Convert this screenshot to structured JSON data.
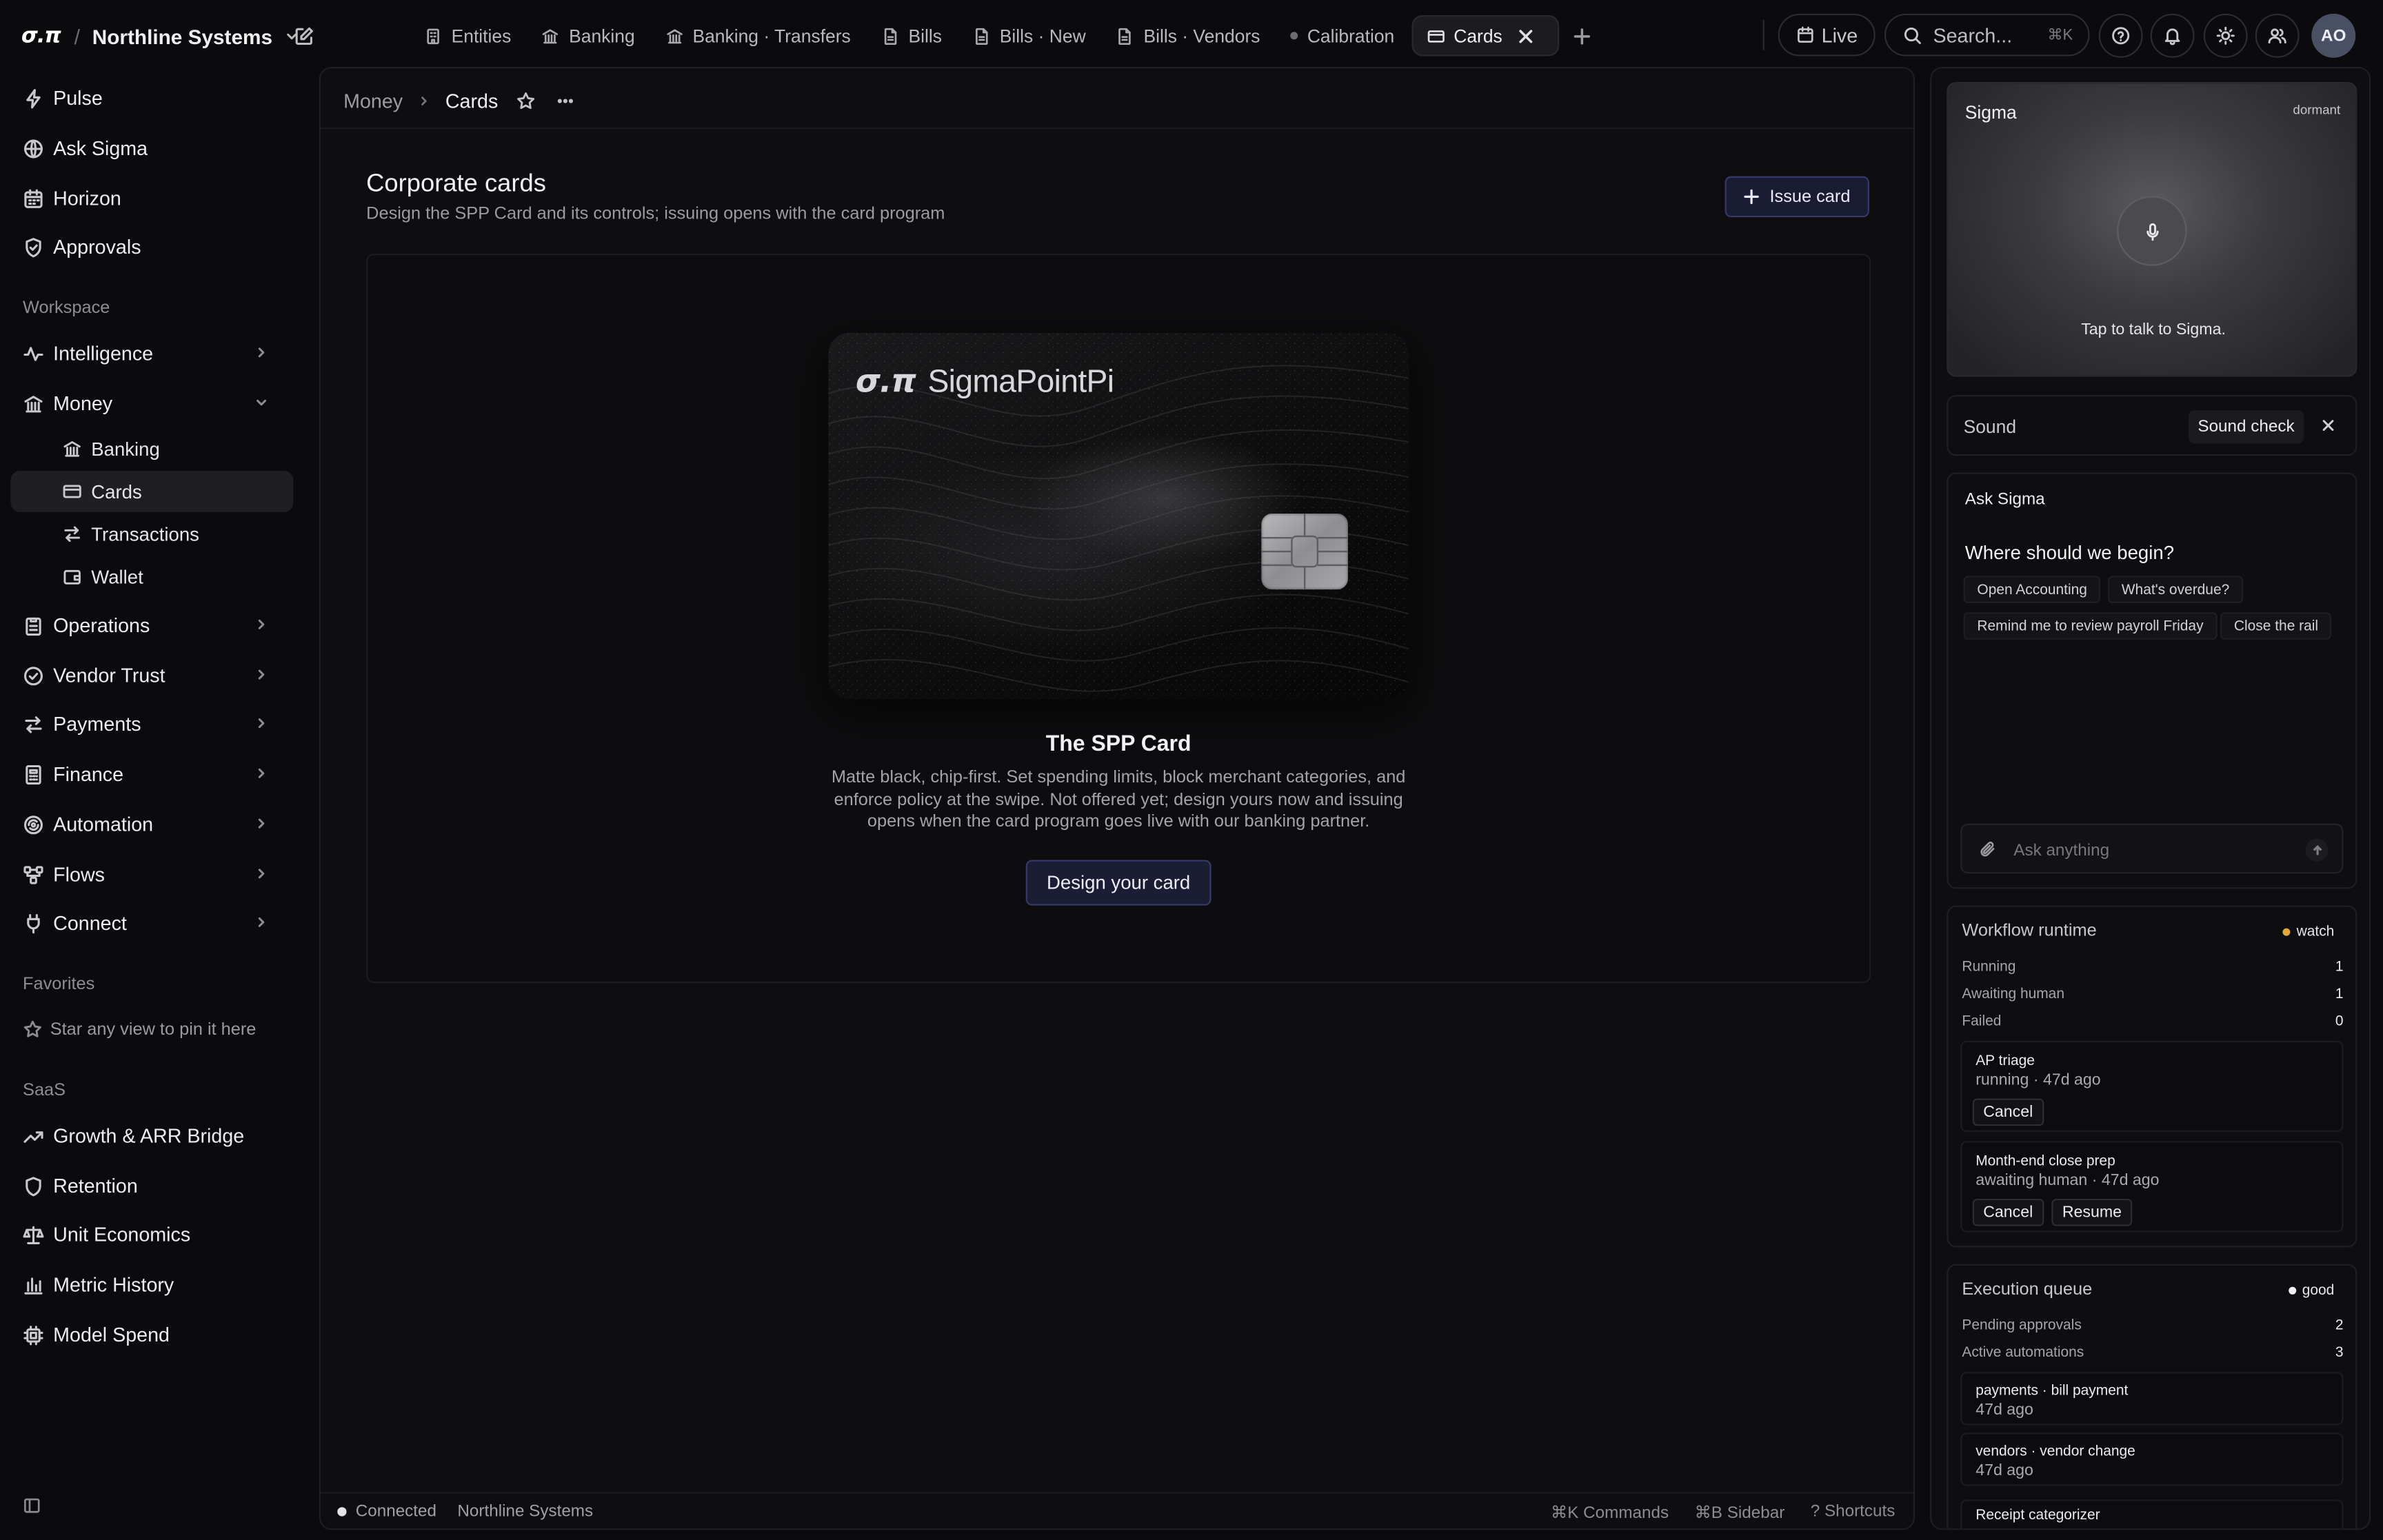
{
  "brand": {
    "logo": "σ.π",
    "workspace": "Northline Systems"
  },
  "tabs": [
    {
      "label": "Entities",
      "icon": "building-icon"
    },
    {
      "label": "Banking",
      "icon": "bank-icon"
    },
    {
      "label": "Banking · Transfers",
      "icon": "bank-icon"
    },
    {
      "label": "Bills",
      "icon": "document-icon"
    },
    {
      "label": "Bills · New",
      "icon": "document-icon"
    },
    {
      "label": "Bills · Vendors",
      "icon": "document-icon"
    },
    {
      "label": "Calibration",
      "icon": "dot-icon"
    },
    {
      "label": "Cards",
      "icon": "card-icon",
      "active": true
    }
  ],
  "topbar": {
    "live_label": "Live",
    "search_placeholder": "Search...",
    "search_shortcut": "⌘K",
    "avatar_initials": "AO"
  },
  "sidebar": {
    "primary": [
      "Pulse",
      "Ask Sigma",
      "Horizon",
      "Approvals"
    ],
    "workspace_label": "Workspace",
    "workspace": {
      "intelligence": "Intelligence",
      "money": "Money",
      "money_children": [
        "Banking",
        "Cards",
        "Transactions",
        "Wallet"
      ],
      "rest": [
        "Operations",
        "Vendor Trust",
        "Payments",
        "Finance",
        "Automation",
        "Flows",
        "Connect"
      ]
    },
    "favorites_label": "Favorites",
    "favorites_hint": "Star any view to pin it here",
    "saas_label": "SaaS",
    "saas": [
      "Growth & ARR Bridge",
      "Retention",
      "Unit Economics",
      "Metric History",
      "Model Spend"
    ]
  },
  "breadcrumb": {
    "root": "Money",
    "current": "Cards"
  },
  "page": {
    "title": "Corporate cards",
    "subtitle": "Design the SPP Card and its controls; issuing opens with the card program",
    "issue_button": "Issue card",
    "card_logo_mark": "σ.π",
    "card_logo_text": "SigmaPointPi",
    "card_name": "The SPP Card",
    "card_description": "Matte black, chip-first. Set spending limits, block merchant categories, and enforce policy at the swipe. Not offered yet; design yours now and issuing opens when the card program goes live with our banking partner.",
    "design_button": "Design your card"
  },
  "statusbar": {
    "connection": "Connected",
    "org": "Northline Systems",
    "shortcuts": [
      "⌘K Commands",
      "⌘B Sidebar",
      "? Shortcuts"
    ]
  },
  "right": {
    "sigma": {
      "title": "Sigma",
      "state": "dormant",
      "hint": "Tap to talk to Sigma."
    },
    "sound": {
      "label": "Sound",
      "button": "Sound check"
    },
    "ask": {
      "title": "Ask Sigma",
      "question": "Where should we begin?",
      "chips": [
        "Open Accounting",
        "What's overdue?",
        "Remind me to review payroll Friday",
        "Close the rail"
      ],
      "placeholder": "Ask anything"
    },
    "workflow": {
      "title": "Workflow runtime",
      "badge": "watch",
      "badge_color": "#e0a93a",
      "stats": [
        {
          "label": "Running",
          "value": "1"
        },
        {
          "label": "Awaiting human",
          "value": "1"
        },
        {
          "label": "Failed",
          "value": "0"
        }
      ],
      "items": [
        {
          "title": "AP triage",
          "meta": "running · 47d ago",
          "actions": [
            "Cancel"
          ]
        },
        {
          "title": "Month-end close prep",
          "meta": "awaiting human · 47d ago",
          "actions": [
            "Cancel",
            "Resume"
          ]
        }
      ]
    },
    "queue": {
      "title": "Execution queue",
      "badge": "good",
      "badge_color": "#f0f0f2",
      "stats": [
        {
          "label": "Pending approvals",
          "value": "2"
        },
        {
          "label": "Active automations",
          "value": "3"
        }
      ],
      "items": [
        {
          "title": "payments · bill payment",
          "meta": "47d ago"
        },
        {
          "title": "vendors · vendor change",
          "meta": "47d ago"
        },
        {
          "title": "Receipt categorizer",
          "meta": ""
        }
      ]
    }
  }
}
